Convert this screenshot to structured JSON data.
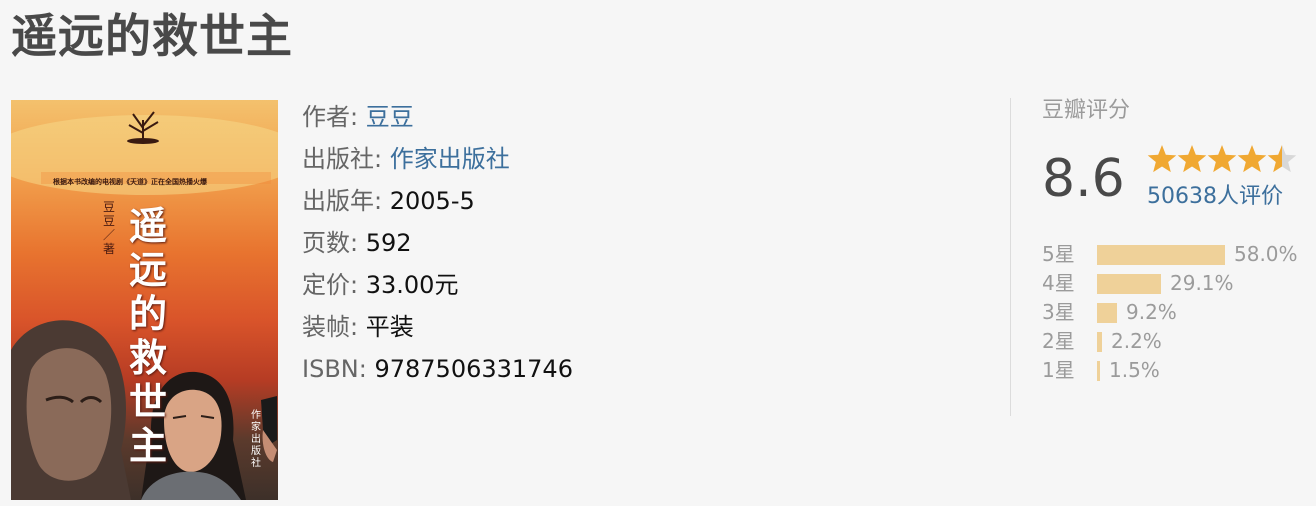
{
  "book": {
    "title": "遥远的救世主",
    "cover": {
      "tagline": "根据本书改编的电视剧《天道》正在全国热播火爆",
      "title": "遥远的救世主",
      "author": "豆豆／著",
      "publisher": "作家出版社"
    },
    "info": [
      {
        "label": "作者:",
        "value": "豆豆",
        "link": true
      },
      {
        "label": "出版社:",
        "value": "作家出版社",
        "link": true
      },
      {
        "label": "出版年:",
        "value": "2005-5",
        "link": false
      },
      {
        "label": "页数:",
        "value": "592",
        "link": false
      },
      {
        "label": "定价:",
        "value": "33.00元",
        "link": false
      },
      {
        "label": "装帧:",
        "value": "平装",
        "link": false
      },
      {
        "label": "ISBN:",
        "value": "9787506331746",
        "link": false
      }
    ]
  },
  "rating": {
    "title": "豆瓣评分",
    "score": "8.6",
    "stars_value": 4.5,
    "votes": "50638人评价",
    "distribution": [
      {
        "label": "5星",
        "percent": 58.0,
        "text": "58.0%"
      },
      {
        "label": "4星",
        "percent": 29.1,
        "text": "29.1%"
      },
      {
        "label": "3星",
        "percent": 9.2,
        "text": "9.2%"
      },
      {
        "label": "2星",
        "percent": 2.2,
        "text": "2.2%"
      },
      {
        "label": "1星",
        "percent": 1.5,
        "text": "1.5%"
      }
    ]
  },
  "colors": {
    "star": "#f0a832",
    "star_empty": "#d8d8d8",
    "bar": "#efd199",
    "link": "#3c6f9c"
  }
}
